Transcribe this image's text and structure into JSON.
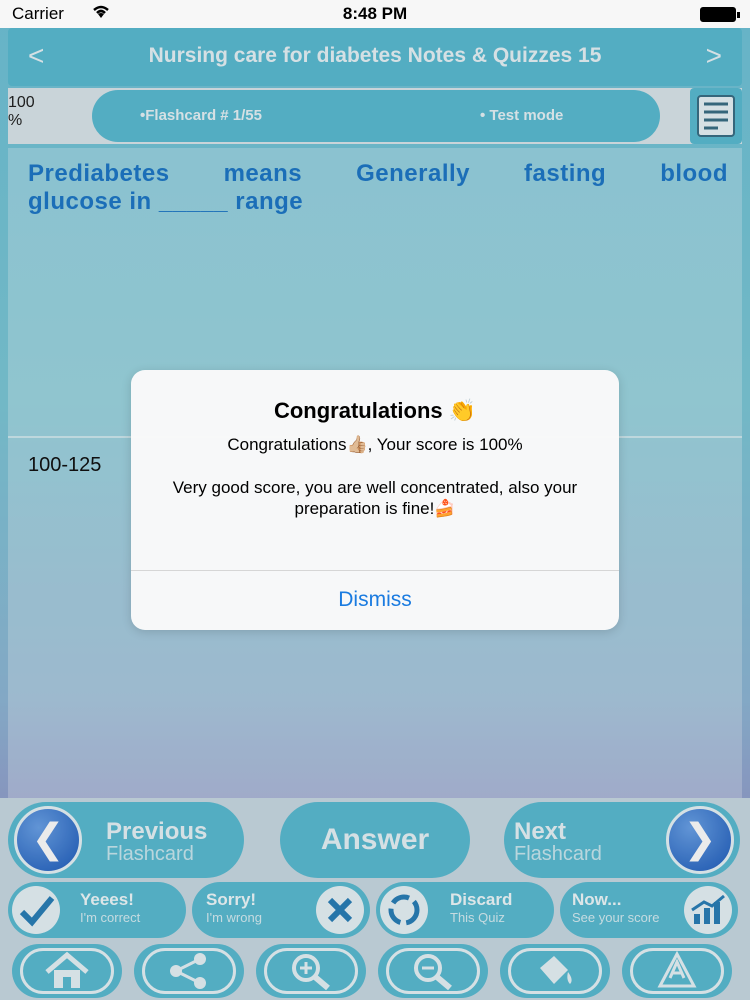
{
  "status_bar": {
    "carrier": "Carrier",
    "time": "8:48 PM"
  },
  "header": {
    "title": "Nursing care for diabetes Notes & Quizzes 15",
    "prev_glyph": "<",
    "next_glyph": ">"
  },
  "info": {
    "percent": "100 %",
    "flashcard": "•Flashcard #  1/55",
    "mode": "• Test mode"
  },
  "question": {
    "line1": "Prediabetes means Generally fasting blood",
    "line2": "glucose in _____ range"
  },
  "answer": {
    "text": "100-125"
  },
  "alert": {
    "title": "Congratulations",
    "title_emoji": "👏",
    "message1": "Congratulations👍🏼, Your score is 100%",
    "message2": "Very good score, you are well concentrated, also your preparation is fine!🍰",
    "dismiss": "Dismiss"
  },
  "controls": {
    "previous": {
      "big": "Previous",
      "small": "Flashcard"
    },
    "answer": "Answer",
    "next": {
      "big": "Next",
      "small": "Flashcard"
    },
    "correct": {
      "big": "Yeees!",
      "small": "I'm correct"
    },
    "wrong": {
      "big": "Sorry!",
      "small": "I'm wrong"
    },
    "discard": {
      "big": "Discard",
      "small": "This Quiz"
    },
    "score": {
      "big": "Now...",
      "small": "See your score"
    }
  },
  "icons": {
    "home": "home-icon",
    "share": "share-icon",
    "zoom_in": "zoom-in-icon",
    "zoom_out": "zoom-out-icon",
    "paint": "paint-bucket-icon",
    "font": "font-icon"
  },
  "colors": {
    "accent": "#5bbcd3",
    "question_text": "#1e78c8",
    "link": "#1a7be0"
  }
}
